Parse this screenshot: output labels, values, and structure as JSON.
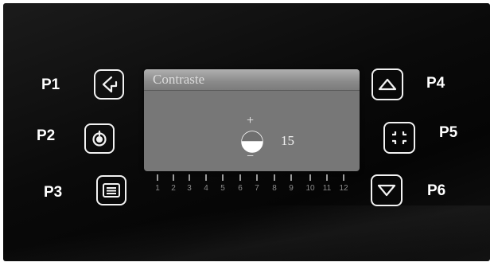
{
  "labels": {
    "p1": "P1",
    "p2": "P2",
    "p3": "P3",
    "p4": "P4",
    "p5": "P5",
    "p6": "P6"
  },
  "buttons": {
    "p1": {
      "icon": "back-arrow-icon"
    },
    "p2": {
      "icon": "power-icon"
    },
    "p3": {
      "icon": "menu-list-icon"
    },
    "p4": {
      "icon": "triangle-up-icon"
    },
    "p5": {
      "icon": "center-focus-icon"
    },
    "p6": {
      "icon": "triangle-down-icon"
    }
  },
  "dialog": {
    "title": "Contraste",
    "plus": "+",
    "minus": "−",
    "value": "15",
    "icon": "contrast-half-circle-icon"
  },
  "scale": {
    "ticks": [
      "1",
      "2",
      "3",
      "4",
      "5",
      "6",
      "7",
      "8",
      "9",
      "10",
      "11",
      "12"
    ]
  },
  "colors": {
    "panel": "#0a0a0a",
    "dialog": "#777777",
    "header": "#9a9a9a",
    "text": "#ffffff"
  }
}
